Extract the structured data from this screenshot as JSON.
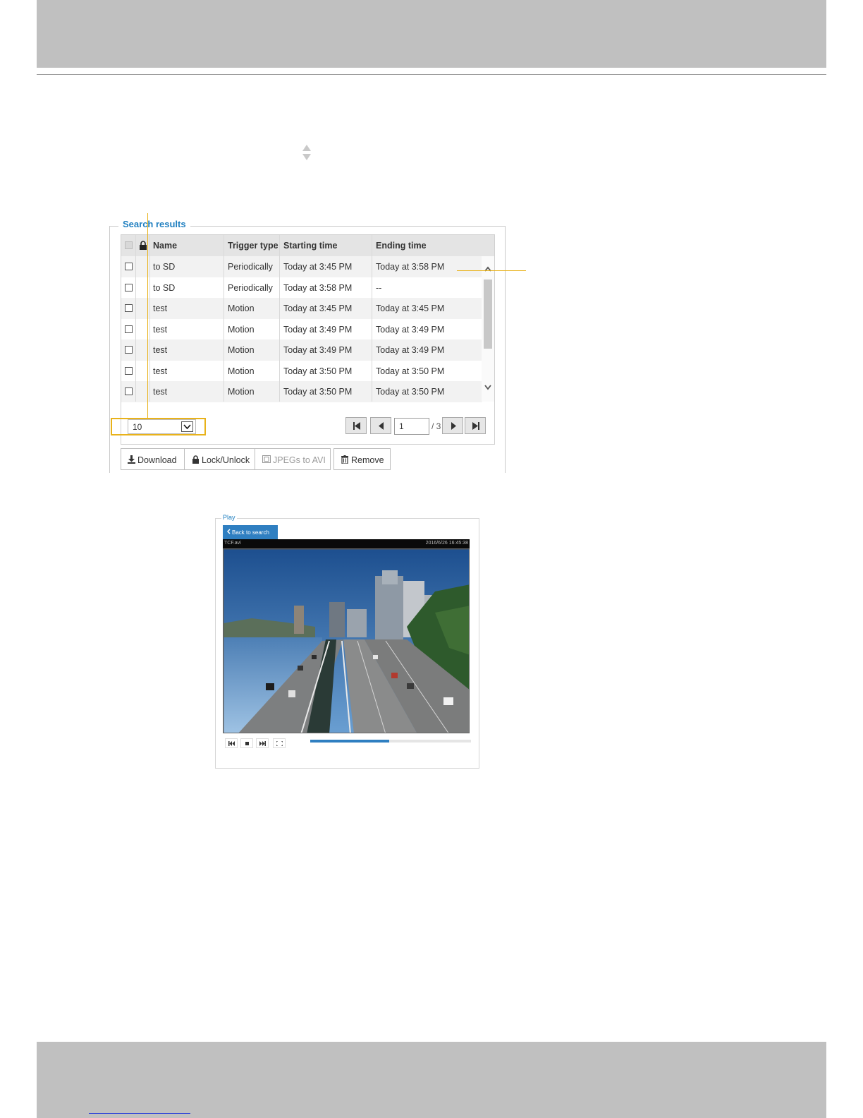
{
  "search_results": {
    "legend": "Search results",
    "columns": [
      "Name",
      "Trigger type",
      "Starting time",
      "Ending time"
    ],
    "rows": [
      {
        "name": "to SD",
        "trigger": "Periodically",
        "start": "Today at 3:45 PM",
        "end": "Today at 3:58 PM"
      },
      {
        "name": "to SD",
        "trigger": "Periodically",
        "start": "Today at 3:58 PM",
        "end": "--"
      },
      {
        "name": "test",
        "trigger": "Motion",
        "start": "Today at 3:45 PM",
        "end": "Today at 3:45 PM"
      },
      {
        "name": "test",
        "trigger": "Motion",
        "start": "Today at 3:49 PM",
        "end": "Today at 3:49 PM"
      },
      {
        "name": "test",
        "trigger": "Motion",
        "start": "Today at 3:49 PM",
        "end": "Today at 3:49 PM"
      },
      {
        "name": "test",
        "trigger": "Motion",
        "start": "Today at 3:50 PM",
        "end": "Today at 3:50 PM"
      },
      {
        "name": "test",
        "trigger": "Motion",
        "start": "Today at 3:50 PM",
        "end": "Today at 3:50 PM"
      }
    ],
    "page_size": "10",
    "current_page": "1",
    "total_pages": "/ 3",
    "actions": {
      "download": "Download",
      "lock_unlock": "Lock/Unlock",
      "jpegs_to_avi": "JPEGs to AVI",
      "remove": "Remove"
    }
  },
  "play": {
    "legend": "Play",
    "back_label": "Back to search",
    "video_left_label": "TCF.avi",
    "video_timestamp": "2016/6/26 16:45:38",
    "progress": 0.49
  },
  "colors": {
    "accent": "#2f7fc1",
    "annotation": "#e8b21a",
    "band": "#c0c0c0"
  }
}
